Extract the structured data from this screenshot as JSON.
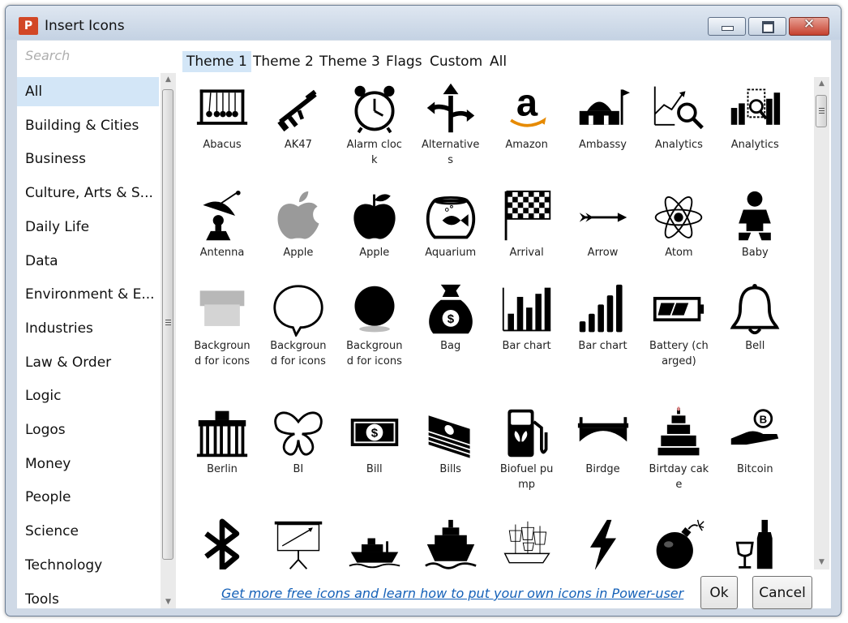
{
  "window": {
    "app_icon_letter": "P",
    "title": "Insert Icons",
    "minimize_icon": "minimize-icon",
    "maximize_icon": "maximize-icon",
    "close_glyph": "✕"
  },
  "search": {
    "placeholder": "Search",
    "value": ""
  },
  "categories": [
    {
      "label": "All",
      "selected": true
    },
    {
      "label": "Building & Cities"
    },
    {
      "label": "Business"
    },
    {
      "label": "Culture, Arts & S..."
    },
    {
      "label": "Daily Life"
    },
    {
      "label": "Data"
    },
    {
      "label": "Environment & E..."
    },
    {
      "label": "Industries"
    },
    {
      "label": "Law & Order"
    },
    {
      "label": "Logic"
    },
    {
      "label": "Logos"
    },
    {
      "label": "Money"
    },
    {
      "label": "People"
    },
    {
      "label": "Science"
    },
    {
      "label": "Technology"
    },
    {
      "label": "Tools"
    }
  ],
  "tabs": [
    {
      "label": "Theme 1",
      "active": true
    },
    {
      "label": "Theme 2"
    },
    {
      "label": "Theme 3"
    },
    {
      "label": "Flags"
    },
    {
      "label": "Custom"
    },
    {
      "label": "All"
    }
  ],
  "icons": [
    {
      "label": "Abacus",
      "icon": "abacus-icon"
    },
    {
      "label": "AK47",
      "icon": "ak47-icon"
    },
    {
      "label": "Alarm clock",
      "icon": "alarm-clock-icon"
    },
    {
      "label": "Alternatives",
      "icon": "alternatives-icon"
    },
    {
      "label": "Amazon",
      "icon": "amazon-icon"
    },
    {
      "label": "Ambassy",
      "icon": "ambassy-icon"
    },
    {
      "label": "Analytics",
      "icon": "analytics-magnifier-icon"
    },
    {
      "label": "Analytics",
      "icon": "analytics-bars-icon"
    },
    {
      "label": "Antenna",
      "icon": "antenna-icon"
    },
    {
      "label": "Apple",
      "icon": "apple-logo-icon"
    },
    {
      "label": "Apple",
      "icon": "apple-fruit-icon"
    },
    {
      "label": "Aquarium",
      "icon": "aquarium-icon"
    },
    {
      "label": "Arrival",
      "icon": "arrival-flag-icon"
    },
    {
      "label": "Arrow",
      "icon": "arrow-icon"
    },
    {
      "label": "Atom",
      "icon": "atom-icon"
    },
    {
      "label": "Baby",
      "icon": "baby-icon"
    },
    {
      "label": "Background for icons",
      "icon": "background-banner-icon"
    },
    {
      "label": "Background for icons",
      "icon": "background-bubble-icon"
    },
    {
      "label": "Background for icons",
      "icon": "background-circle-icon"
    },
    {
      "label": "Bag",
      "icon": "money-bag-icon"
    },
    {
      "label": "Bar chart",
      "icon": "bar-chart-icon"
    },
    {
      "label": "Bar chart",
      "icon": "bar-chart-rising-icon"
    },
    {
      "label": "Battery (charged)",
      "icon": "battery-icon"
    },
    {
      "label": "Bell",
      "icon": "bell-icon"
    },
    {
      "label": "Berlin",
      "icon": "berlin-gate-icon"
    },
    {
      "label": "BI",
      "icon": "butterfly-icon"
    },
    {
      "label": "Bill",
      "icon": "bill-icon"
    },
    {
      "label": "Bills",
      "icon": "bills-stack-icon"
    },
    {
      "label": "Biofuel pump",
      "icon": "biofuel-pump-icon"
    },
    {
      "label": "Birdge",
      "icon": "bridge-icon"
    },
    {
      "label": "Birtday cake",
      "icon": "birthday-cake-icon"
    },
    {
      "label": "Bitcoin",
      "icon": "bitcoin-icon"
    },
    {
      "label": "",
      "icon": "bluetooth-icon"
    },
    {
      "label": "",
      "icon": "projector-screen-icon"
    },
    {
      "label": "",
      "icon": "boat-icon"
    },
    {
      "label": "",
      "icon": "ship-icon"
    },
    {
      "label": "",
      "icon": "sailing-ship-icon"
    },
    {
      "label": "",
      "icon": "lightning-icon"
    },
    {
      "label": "",
      "icon": "bomb-icon"
    },
    {
      "label": "",
      "icon": "wine-bottle-icon"
    }
  ],
  "footer": {
    "more_link": "Get more free icons and learn how to put your own icons in Power-user",
    "ok_label": "Ok",
    "cancel_label": "Cancel"
  },
  "colors": {
    "selection": "#d3e6f7",
    "link": "#1561b8",
    "close_button": "#c6412f",
    "powerpoint_orange": "#d24726"
  }
}
